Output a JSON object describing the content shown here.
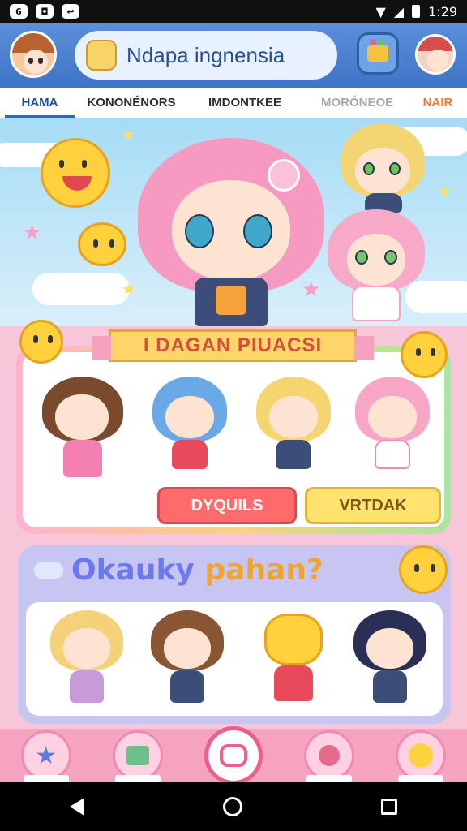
{
  "status": {
    "time": "1:29"
  },
  "header": {
    "title": "Ndapa ingnensia"
  },
  "tabs": [
    {
      "label": "HAMA"
    },
    {
      "label": "KONONÉNORS"
    },
    {
      "label": "IMDONTKEE"
    },
    {
      "label": "MORÓNEOE"
    },
    {
      "label": "NAIR"
    }
  ],
  "collection": {
    "ribbon_title": "I DAGAN PIUACSI",
    "button_red": "DYQUILS",
    "button_yellow": "VRTDAK"
  },
  "stickers": {
    "title_part1": "Okauky",
    "title_part2": " pahan?"
  },
  "colors": {
    "header_blue": "#3f74c7",
    "accent_pink": "#ef5c8e",
    "accent_yellow": "#ffd46b"
  }
}
